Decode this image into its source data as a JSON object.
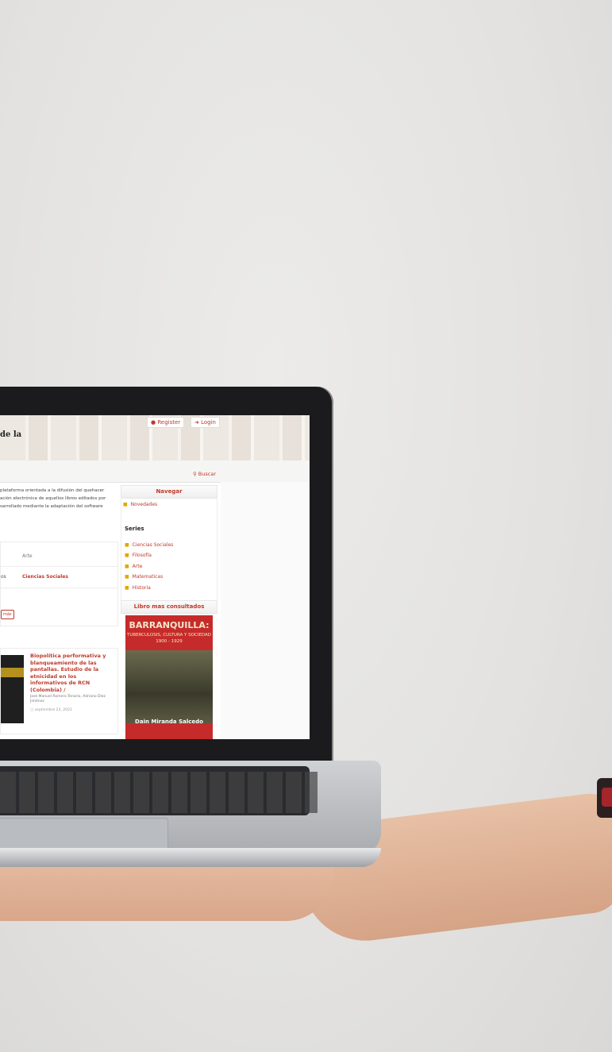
{
  "header": {
    "site_title": "de la",
    "register_label": "Register",
    "login_label": "Login",
    "search_label": "Buscar"
  },
  "main": {
    "intro_lines": [
      "plataforma orientada a la difusión del quehacer",
      "ación electrónica de aquellos libros editados por",
      "sarrollado mediante la adaptación del software"
    ],
    "series_card": {
      "col_header": "Arte",
      "left_cell": "os",
      "series_link": "Ciencias Sociales",
      "more_button": "más"
    },
    "book": {
      "title": "Biopolítica performativa y blanqueamiento de las pantallas. Estudio de la etnicidad en los informativos de RCN (Colombia) /",
      "authors": "José Manuel Romero Tenorio, Adriano Díez Jiménez",
      "date": "septiembre 23, 2023",
      "thumb_text": "erformativa"
    }
  },
  "sidebar": {
    "nav_heading": "Navegar",
    "novedades": "Novedades",
    "series_heading": "Series",
    "series": [
      "Ciencias Sociales",
      "Filosofía",
      "Arte",
      "Matematicas",
      "Historia"
    ],
    "popular_heading": "Libro mas consultados",
    "cover": {
      "title": "BARRANQUILLA:",
      "subtitle": "TUBERCULOSIS, CULTURA Y SOCIEDAD",
      "years": "1900 - 1929",
      "author": "Dain Miranda Salcedo"
    }
  },
  "colors": {
    "accent": "#c0392b",
    "bullet": "#e0a800"
  }
}
